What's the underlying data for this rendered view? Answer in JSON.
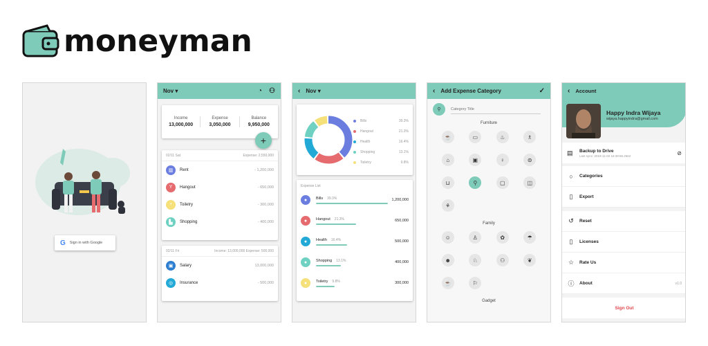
{
  "brand": {
    "name": "moneyman",
    "accent": "#7fcbb9"
  },
  "login": {
    "google_button": "Sign in with Google"
  },
  "home": {
    "month": "Nov",
    "summary": [
      {
        "label": "Income",
        "value": "13,000,000"
      },
      {
        "label": "Expense",
        "value": "3,050,000"
      },
      {
        "label": "Balance",
        "value": "9,950,000"
      }
    ],
    "add_label": "+",
    "day1": {
      "date": "02/11 Sat",
      "totals": "Expense: 2,550,000",
      "items": [
        {
          "name": "Rent",
          "amount": "- 1,200,000",
          "color": "#6b7ee0",
          "icon": "building-icon"
        },
        {
          "name": "Hangout",
          "amount": "- 650,000",
          "color": "#e56b6f",
          "icon": "cocktail-icon"
        },
        {
          "name": "Toiletry",
          "amount": "- 300,000",
          "color": "#f5e07a",
          "icon": "toilet-icon"
        },
        {
          "name": "Shopping",
          "amount": "- 400,000",
          "color": "#6fd1c1",
          "icon": "shoe-icon"
        }
      ]
    },
    "day2": {
      "date": "02/11 Fri",
      "totals": "Income: 13,000,000   Expense: 500,000",
      "items": [
        {
          "name": "Salary",
          "amount": "13,000,000",
          "color": "#2f7fd1",
          "icon": "wallet-icon"
        },
        {
          "name": "Insurance",
          "amount": "- 500,000",
          "color": "#23a9d6",
          "icon": "shield-icon"
        }
      ]
    }
  },
  "stats": {
    "month": "Nov",
    "legend": [
      {
        "name": "Bills",
        "pct": "39.3%",
        "color": "#6b7ee0"
      },
      {
        "name": "Hangout",
        "pct": "21.3%",
        "color": "#e56b6f"
      },
      {
        "name": "Health",
        "pct": "16.4%",
        "color": "#23a9d6"
      },
      {
        "name": "Shopping",
        "pct": "13.1%",
        "color": "#6fd1c1"
      },
      {
        "name": "Toiletry",
        "pct": "9.8%",
        "color": "#f5e07a"
      }
    ],
    "list_title": "Expense List",
    "list": [
      {
        "name": "Bills",
        "pct": "39.3%",
        "amount": "1,200,000",
        "fill": 1.0,
        "color": "#6b7ee0"
      },
      {
        "name": "Hangout",
        "pct": "21.3%",
        "amount": "650,000",
        "fill": 0.54,
        "color": "#e56b6f"
      },
      {
        "name": "Health",
        "pct": "16.4%",
        "amount": "500,000",
        "fill": 0.42,
        "color": "#23a9d6"
      },
      {
        "name": "Shopping",
        "pct": "13.1%",
        "amount": "400,000",
        "fill": 0.33,
        "color": "#6fd1c1"
      },
      {
        "name": "Toiletry",
        "pct": "9.8%",
        "amount": "300,000",
        "fill": 0.25,
        "color": "#f5e07a"
      }
    ]
  },
  "category": {
    "title": "Add Expense Category",
    "placeholder": "Category Title",
    "sections": [
      "Furniture",
      "Family",
      "Gadget"
    ],
    "furniture_icons": [
      "☕",
      "▭",
      "♨",
      "♗",
      "⌂",
      "▣",
      "♀",
      "⊜",
      "⊔",
      "⚲",
      "▢",
      "◫",
      "⚘"
    ],
    "family_icons": [
      "☺",
      "♙",
      "✿",
      "☂",
      "☻",
      "♘",
      "⚇",
      "❦",
      "☕",
      "⚐"
    ]
  },
  "account": {
    "title": "Account",
    "user_name": "Happy Indra Wijaya",
    "email": "wijaya.happyindra@gmail.com",
    "backup_title": "Backup to Drive",
    "backup_sub": "Last sync: 2019-11-02 15:38:56.2662",
    "menu": [
      "Categories",
      "Export",
      "Reset",
      "Licenses",
      "Rate Us",
      "About"
    ],
    "version": "v1.0",
    "sign_out": "Sign Out"
  }
}
